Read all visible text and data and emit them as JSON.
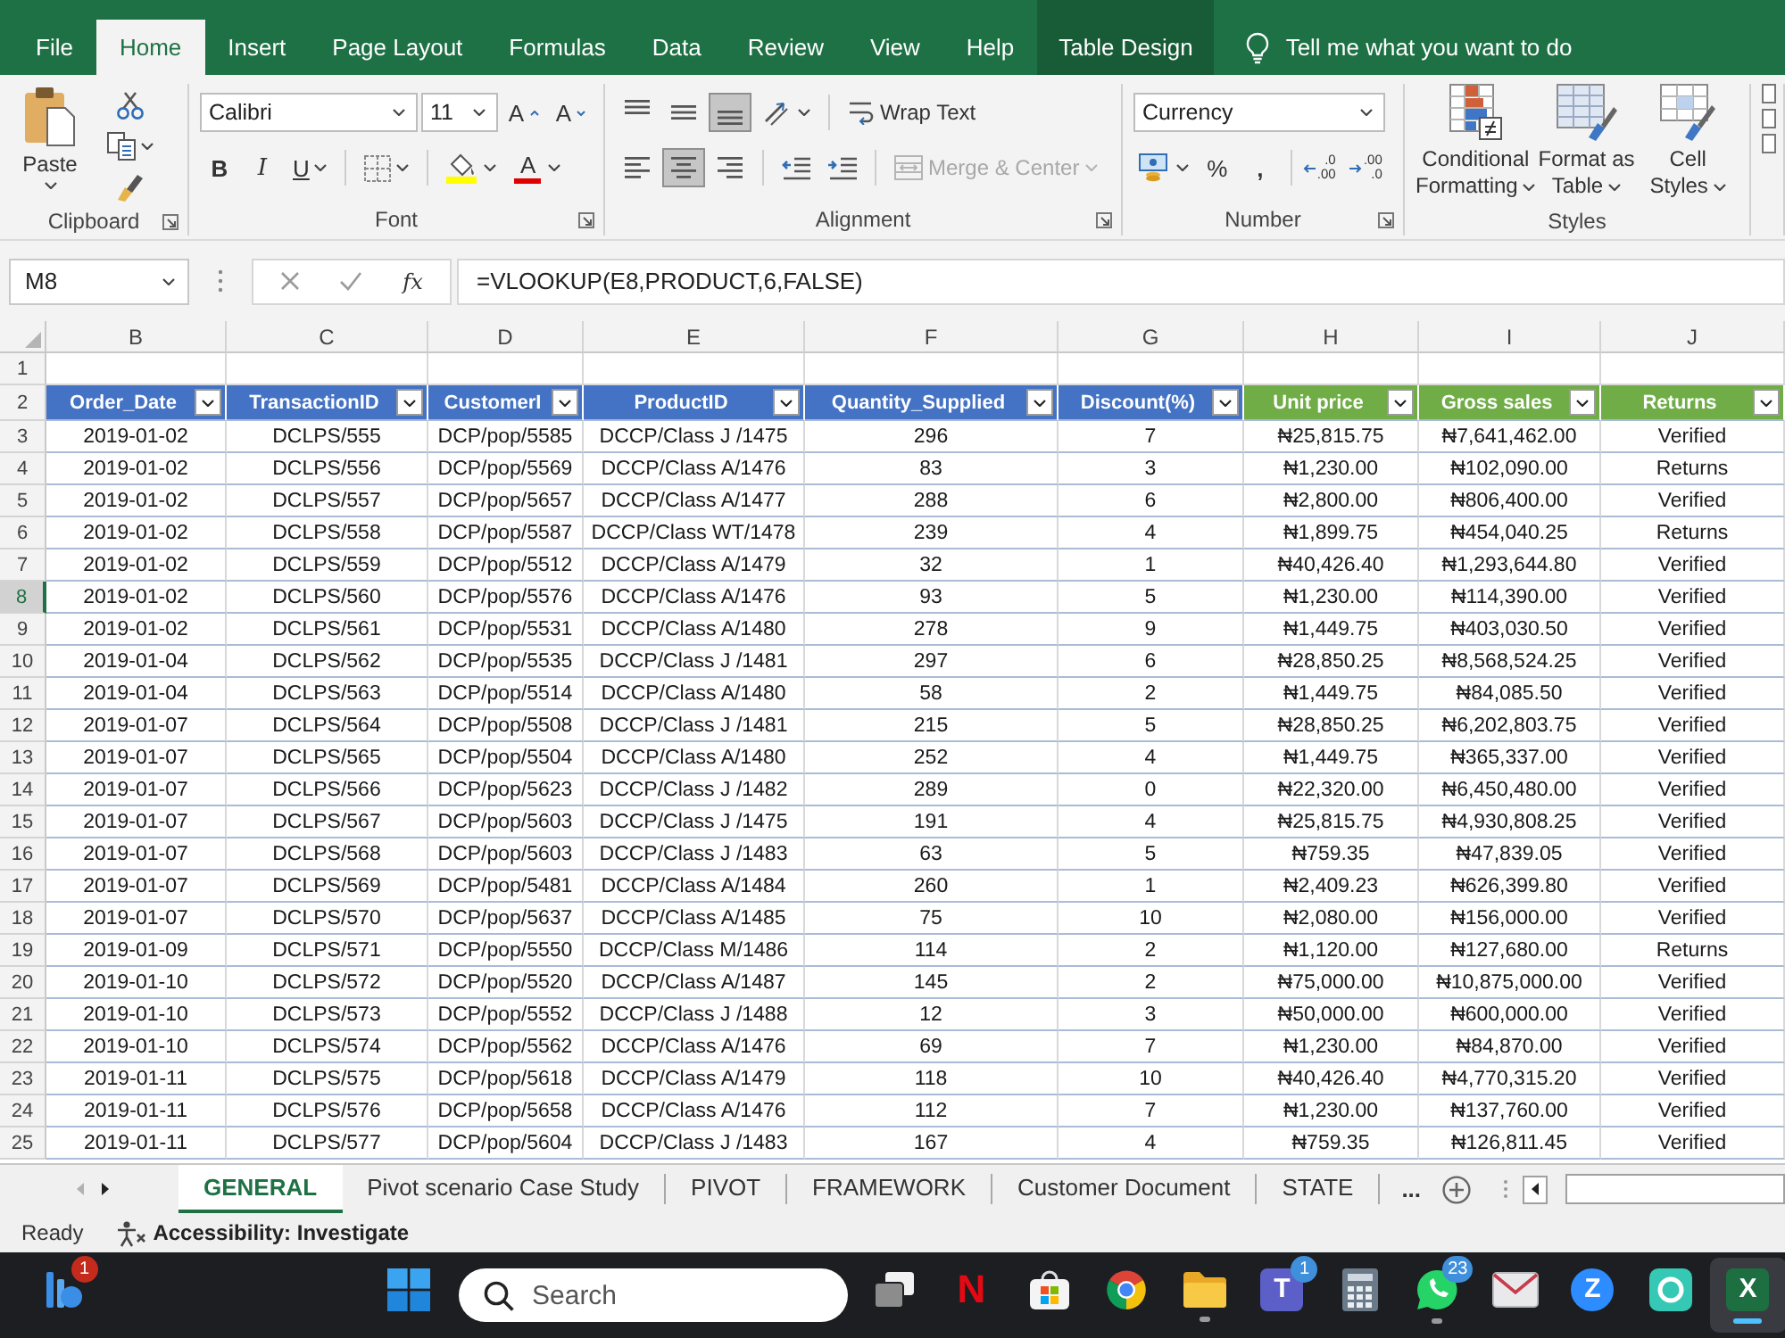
{
  "ribbon_tabs": [
    {
      "label": "File",
      "kind": "standard",
      "selected": false
    },
    {
      "label": "Home",
      "kind": "standard",
      "selected": true
    },
    {
      "label": "Insert",
      "kind": "standard",
      "selected": false
    },
    {
      "label": "Page Layout",
      "kind": "standard",
      "selected": false
    },
    {
      "label": "Formulas",
      "kind": "standard",
      "selected": false
    },
    {
      "label": "Data",
      "kind": "standard",
      "selected": false
    },
    {
      "label": "Review",
      "kind": "standard",
      "selected": false
    },
    {
      "label": "View",
      "kind": "standard",
      "selected": false
    },
    {
      "label": "Help",
      "kind": "standard",
      "selected": false
    },
    {
      "label": "Table Design",
      "kind": "contextual",
      "selected": false
    }
  ],
  "tell_me": {
    "label": "Tell me what you want to do"
  },
  "ribbon": {
    "clipboard": {
      "paste": "Paste",
      "label": "Clipboard"
    },
    "font": {
      "name": "Calibri",
      "size": "11",
      "grow": "A",
      "shrink": "A",
      "styles": [
        {
          "kind": "bold",
          "glyph": "B"
        },
        {
          "kind": "italic",
          "glyph": "I"
        },
        {
          "kind": "underline",
          "glyph": "U"
        }
      ],
      "font_color": "A",
      "label": "Font"
    },
    "alignment": {
      "vertical": [
        {
          "kind": "top",
          "selected": false
        },
        {
          "kind": "middle",
          "selected": false
        },
        {
          "kind": "bottom",
          "selected": true
        }
      ],
      "horizontal": [
        {
          "kind": "left",
          "selected": false
        },
        {
          "kind": "center",
          "selected": true
        },
        {
          "kind": "right",
          "selected": false
        }
      ],
      "wrap": "Wrap Text",
      "merge": {
        "label": "Merge & Center",
        "disabled": true
      },
      "label": "Alignment"
    },
    "number": {
      "format": "Currency",
      "percent": "%",
      "comma": ",",
      "decimals": [
        {
          "kind": "increase",
          "top": ".0",
          "bottom": ".00"
        },
        {
          "kind": "decrease",
          "top": ".00",
          "bottom": ".0"
        }
      ],
      "label": "Number"
    },
    "styles": {
      "items": [
        {
          "kind": "conditional",
          "lines": [
            "Conditional",
            "Formatting"
          ]
        },
        {
          "kind": "table",
          "lines": [
            "Format as",
            "Table"
          ]
        },
        {
          "kind": "cell",
          "lines": [
            "Cell",
            "Styles"
          ]
        }
      ],
      "label": "Styles"
    }
  },
  "formula_bar": {
    "name_box": "M8",
    "fx": "fx",
    "formula": "=VLOOKUP(E8,PRODUCT,6,FALSE)"
  },
  "grid": {
    "columns": [
      "B",
      "C",
      "D",
      "E",
      "F",
      "G",
      "H",
      "I",
      "J"
    ],
    "rows": [
      {
        "number": "1",
        "kind": "blank",
        "selected": false
      },
      {
        "number": "2",
        "kind": "header",
        "selected": false,
        "cells": [
          {
            "label": "Order_Date",
            "color": "#4472c4"
          },
          {
            "label": "TransactionID",
            "color": "#4472c4"
          },
          {
            "label": "CustomerI",
            "color": "#4472c4"
          },
          {
            "label": "ProductID",
            "color": "#4472c4"
          },
          {
            "label": "Quantity_Supplied",
            "color": "#4472c4"
          },
          {
            "label": "Discount(%)",
            "color": "#4472c4"
          },
          {
            "label": "Unit price",
            "color": "#70ad47"
          },
          {
            "label": "Gross sales",
            "color": "#70ad47"
          },
          {
            "label": "Returns",
            "color": "#70ad47"
          }
        ]
      },
      {
        "number": "3",
        "kind": "data",
        "selected": false,
        "cells": [
          "2019-01-02",
          "DCLPS/555",
          "DCP/pop/5585",
          "DCCP/Class J /1475",
          "296",
          "7",
          "₦25,815.75",
          "₦7,641,462.00",
          "Verified"
        ]
      },
      {
        "number": "4",
        "kind": "data",
        "selected": false,
        "cells": [
          "2019-01-02",
          "DCLPS/556",
          "DCP/pop/5569",
          "DCCP/Class A/1476",
          "83",
          "3",
          "₦1,230.00",
          "₦102,090.00",
          "Returns"
        ]
      },
      {
        "number": "5",
        "kind": "data",
        "selected": false,
        "cells": [
          "2019-01-02",
          "DCLPS/557",
          "DCP/pop/5657",
          "DCCP/Class A/1477",
          "288",
          "6",
          "₦2,800.00",
          "₦806,400.00",
          "Verified"
        ]
      },
      {
        "number": "6",
        "kind": "data",
        "selected": false,
        "cells": [
          "2019-01-02",
          "DCLPS/558",
          "DCP/pop/5587",
          "DCCP/Class WT/1478",
          "239",
          "4",
          "₦1,899.75",
          "₦454,040.25",
          "Returns"
        ]
      },
      {
        "number": "7",
        "kind": "data",
        "selected": false,
        "cells": [
          "2019-01-02",
          "DCLPS/559",
          "DCP/pop/5512",
          "DCCP/Class A/1479",
          "32",
          "1",
          "₦40,426.40",
          "₦1,293,644.80",
          "Verified"
        ]
      },
      {
        "number": "8",
        "kind": "data",
        "selected": true,
        "cells": [
          "2019-01-02",
          "DCLPS/560",
          "DCP/pop/5576",
          "DCCP/Class A/1476",
          "93",
          "5",
          "₦1,230.00",
          "₦114,390.00",
          "Verified"
        ]
      },
      {
        "number": "9",
        "kind": "data",
        "selected": false,
        "cells": [
          "2019-01-02",
          "DCLPS/561",
          "DCP/pop/5531",
          "DCCP/Class A/1480",
          "278",
          "9",
          "₦1,449.75",
          "₦403,030.50",
          "Verified"
        ]
      },
      {
        "number": "10",
        "kind": "data",
        "selected": false,
        "cells": [
          "2019-01-04",
          "DCLPS/562",
          "DCP/pop/5535",
          "DCCP/Class J /1481",
          "297",
          "6",
          "₦28,850.25",
          "₦8,568,524.25",
          "Verified"
        ]
      },
      {
        "number": "11",
        "kind": "data",
        "selected": false,
        "cells": [
          "2019-01-04",
          "DCLPS/563",
          "DCP/pop/5514",
          "DCCP/Class A/1480",
          "58",
          "2",
          "₦1,449.75",
          "₦84,085.50",
          "Verified"
        ]
      },
      {
        "number": "12",
        "kind": "data",
        "selected": false,
        "cells": [
          "2019-01-07",
          "DCLPS/564",
          "DCP/pop/5508",
          "DCCP/Class J /1481",
          "215",
          "5",
          "₦28,850.25",
          "₦6,202,803.75",
          "Verified"
        ]
      },
      {
        "number": "13",
        "kind": "data",
        "selected": false,
        "cells": [
          "2019-01-07",
          "DCLPS/565",
          "DCP/pop/5504",
          "DCCP/Class A/1480",
          "252",
          "4",
          "₦1,449.75",
          "₦365,337.00",
          "Verified"
        ]
      },
      {
        "number": "14",
        "kind": "data",
        "selected": false,
        "cells": [
          "2019-01-07",
          "DCLPS/566",
          "DCP/pop/5623",
          "DCCP/Class J /1482",
          "289",
          "0",
          "₦22,320.00",
          "₦6,450,480.00",
          "Verified"
        ]
      },
      {
        "number": "15",
        "kind": "data",
        "selected": false,
        "cells": [
          "2019-01-07",
          "DCLPS/567",
          "DCP/pop/5603",
          "DCCP/Class J /1475",
          "191",
          "4",
          "₦25,815.75",
          "₦4,930,808.25",
          "Verified"
        ]
      },
      {
        "number": "16",
        "kind": "data",
        "selected": false,
        "cells": [
          "2019-01-07",
          "DCLPS/568",
          "DCP/pop/5603",
          "DCCP/Class J /1483",
          "63",
          "5",
          "₦759.35",
          "₦47,839.05",
          "Verified"
        ]
      },
      {
        "number": "17",
        "kind": "data",
        "selected": false,
        "cells": [
          "2019-01-07",
          "DCLPS/569",
          "DCP/pop/5481",
          "DCCP/Class A/1484",
          "260",
          "1",
          "₦2,409.23",
          "₦626,399.80",
          "Verified"
        ]
      },
      {
        "number": "18",
        "kind": "data",
        "selected": false,
        "cells": [
          "2019-01-07",
          "DCLPS/570",
          "DCP/pop/5637",
          "DCCP/Class A/1485",
          "75",
          "10",
          "₦2,080.00",
          "₦156,000.00",
          "Verified"
        ]
      },
      {
        "number": "19",
        "kind": "data",
        "selected": false,
        "cells": [
          "2019-01-09",
          "DCLPS/571",
          "DCP/pop/5550",
          "DCCP/Class M/1486",
          "114",
          "2",
          "₦1,120.00",
          "₦127,680.00",
          "Returns"
        ]
      },
      {
        "number": "20",
        "kind": "data",
        "selected": false,
        "cells": [
          "2019-01-10",
          "DCLPS/572",
          "DCP/pop/5520",
          "DCCP/Class A/1487",
          "145",
          "2",
          "₦75,000.00",
          "₦10,875,000.00",
          "Verified"
        ]
      },
      {
        "number": "21",
        "kind": "data",
        "selected": false,
        "cells": [
          "2019-01-10",
          "DCLPS/573",
          "DCP/pop/5552",
          "DCCP/Class J /1488",
          "12",
          "3",
          "₦50,000.00",
          "₦600,000.00",
          "Verified"
        ]
      },
      {
        "number": "22",
        "kind": "data",
        "selected": false,
        "cells": [
          "2019-01-10",
          "DCLPS/574",
          "DCP/pop/5562",
          "DCCP/Class A/1476",
          "69",
          "7",
          "₦1,230.00",
          "₦84,870.00",
          "Verified"
        ]
      },
      {
        "number": "23",
        "kind": "data",
        "selected": false,
        "cells": [
          "2019-01-11",
          "DCLPS/575",
          "DCP/pop/5618",
          "DCCP/Class A/1479",
          "118",
          "10",
          "₦40,426.40",
          "₦4,770,315.20",
          "Verified"
        ]
      },
      {
        "number": "24",
        "kind": "data",
        "selected": false,
        "cells": [
          "2019-01-11",
          "DCLPS/576",
          "DCP/pop/5658",
          "DCCP/Class A/1476",
          "112",
          "7",
          "₦1,230.00",
          "₦137,760.00",
          "Verified"
        ]
      },
      {
        "number": "25",
        "kind": "data",
        "selected": false,
        "cells": [
          "2019-01-11",
          "DCLPS/577",
          "DCP/pop/5604",
          "DCCP/Class J /1483",
          "167",
          "4",
          "₦759.35",
          "₦126,811.45",
          "Verified"
        ]
      }
    ]
  },
  "sheet_tabs": {
    "items": [
      {
        "label": "GENERAL",
        "selected": true
      },
      {
        "label": "Pivot scenario Case Study",
        "selected": false
      },
      {
        "label": "PIVOT",
        "selected": false
      },
      {
        "label": "FRAMEWORK",
        "selected": false
      },
      {
        "label": "Customer Document",
        "selected": false
      },
      {
        "label": "STATE",
        "selected": false
      }
    ],
    "more": "..."
  },
  "status_bar": {
    "mode": "Ready",
    "accessibility": "Accessibility: Investigate"
  },
  "taskbar": {
    "items": [
      {
        "kind": "widgets",
        "running": false,
        "selected": false,
        "badge": {
          "text": "1",
          "color": "#c42b1c"
        }
      },
      {
        "kind": "start",
        "running": false,
        "selected": false
      },
      {
        "kind": "search",
        "placeholder": "Search"
      },
      {
        "kind": "task_view",
        "running": false,
        "selected": false
      },
      {
        "kind": "letter",
        "glyph": "N",
        "color": "#e50914",
        "running": false,
        "selected": false
      },
      {
        "kind": "store",
        "running": false,
        "selected": false
      },
      {
        "kind": "browser",
        "running": false,
        "selected": false
      },
      {
        "kind": "folder",
        "running": true,
        "selected": false
      },
      {
        "kind": "square_tile",
        "glyph": "T",
        "color": "#5b5fc7",
        "running": false,
        "selected": false,
        "badge": {
          "text": "1",
          "color": "#3f8fdb"
        }
      },
      {
        "kind": "calculator",
        "running": false,
        "selected": false
      },
      {
        "kind": "chat",
        "running": true,
        "selected": false,
        "badge": {
          "text": "23",
          "color": "#3f8fdb"
        }
      },
      {
        "kind": "mail",
        "running": false,
        "selected": false
      },
      {
        "kind": "round_tile",
        "glyph": "Z",
        "color": "#2d8cff",
        "running": false,
        "selected": false
      },
      {
        "kind": "ring_tile",
        "color": "#35c8b5",
        "running": false,
        "selected": false
      },
      {
        "kind": "square_tile",
        "glyph": "X",
        "color": "#1d6f42",
        "running": true,
        "selected": true
      }
    ]
  }
}
